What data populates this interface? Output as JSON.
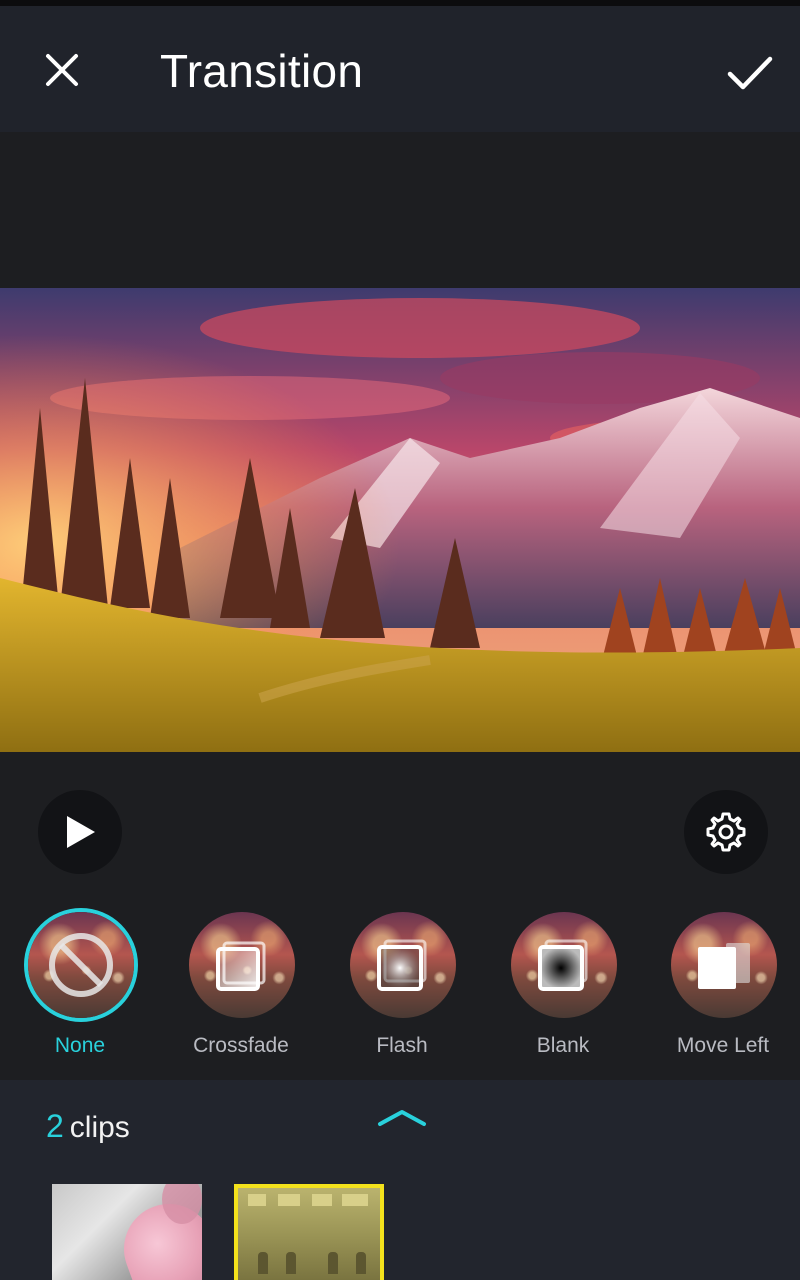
{
  "header": {
    "title": "Transition",
    "close_icon": "close-icon",
    "confirm_icon": "checkmark-icon"
  },
  "preview": {
    "image_icon": "mountain-landscape-image"
  },
  "controls": {
    "play_icon": "play-icon",
    "settings_icon": "gear-icon"
  },
  "transitions": {
    "selected": "None",
    "items": [
      {
        "label": "None",
        "icon": "no-transition-icon"
      },
      {
        "label": "Crossfade",
        "icon": "crossfade-icon"
      },
      {
        "label": "Flash",
        "icon": "flash-icon"
      },
      {
        "label": "Blank",
        "icon": "blank-icon"
      },
      {
        "label": "Move Left",
        "icon": "move-left-icon"
      }
    ]
  },
  "clips": {
    "count": "2",
    "label": "clips",
    "expand_icon": "chevron-up-icon",
    "items": [
      {
        "icon": "clip-thumbnail-flower"
      },
      {
        "icon": "clip-thumbnail-room",
        "selected": true
      }
    ]
  },
  "colors": {
    "accent": "#29d1dc",
    "selected_clip_border": "#f4e21c",
    "topbar_bg": "#20232b",
    "panel_bg": "#1d1e21"
  }
}
